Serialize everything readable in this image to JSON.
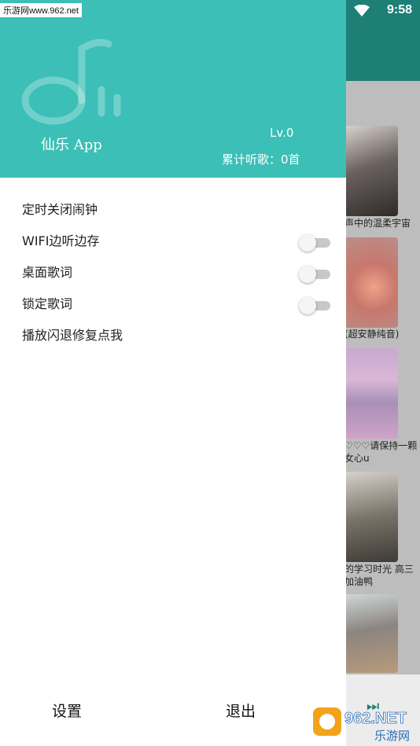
{
  "status_bar": {
    "time": "9:58",
    "site_tag": "乐游网www.962.net"
  },
  "drawer": {
    "header": {
      "app_name": "仙乐 App",
      "level": "Lv.0",
      "song_count": "累计听歌：0首"
    },
    "menu": [
      {
        "label": "定时关闭闹钟"
      },
      {
        "label": "WIFI边听边存",
        "toggle": false
      },
      {
        "label": "桌面歌词",
        "toggle": false
      },
      {
        "label": "锁定歌词",
        "toggle": false
      },
      {
        "label": "播放闪退修复点我"
      }
    ],
    "footer": {
      "settings_label": "设置",
      "exit_label": "退出"
    }
  },
  "background": {
    "captions": [
      "声中的温柔宇宙",
      "(超安静纯音)",
      "♡♡♡请保持一颗女心u",
      "的学习时光 高三加油鸭"
    ]
  },
  "watermark": {
    "brand": "962.NET",
    "name": "乐游网"
  },
  "colors": {
    "accent": "#3bbfb6",
    "topbar_dark": "#1e7f77"
  }
}
